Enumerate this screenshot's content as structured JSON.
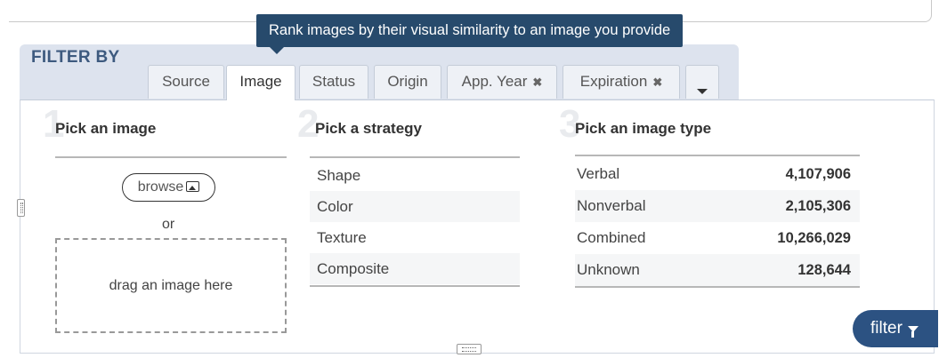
{
  "tooltip": "Rank images by their visual similarity to an image you provide",
  "header": {
    "title": "FILTER BY"
  },
  "tabs": [
    {
      "label": "Source",
      "closable": false
    },
    {
      "label": "Image",
      "closable": false,
      "active": true
    },
    {
      "label": "Status",
      "closable": false
    },
    {
      "label": "Origin",
      "closable": false
    },
    {
      "label": "App. Year",
      "closable": true
    },
    {
      "label": "Expiration",
      "closable": true
    }
  ],
  "close_glyph": "✖",
  "steps": {
    "image": {
      "number": "1",
      "title": "Pick an image",
      "browse_label": "browse",
      "or_label": "or",
      "drop_label": "drag an image here"
    },
    "strategy": {
      "number": "2",
      "title": "Pick a strategy",
      "options": [
        "Shape",
        "Color",
        "Texture",
        "Composite"
      ]
    },
    "type": {
      "number": "3",
      "title": "Pick an image type",
      "options": [
        {
          "label": "Verbal",
          "count": "4,107,906"
        },
        {
          "label": "Nonverbal",
          "count": "2,105,306"
        },
        {
          "label": "Combined",
          "count": "10,266,029"
        },
        {
          "label": "Unknown",
          "count": "128,644"
        }
      ]
    }
  },
  "filter_button": "filter",
  "icons": {
    "image": "image-icon",
    "funnel": "funnel-icon",
    "more": "chevron-down-icon"
  }
}
